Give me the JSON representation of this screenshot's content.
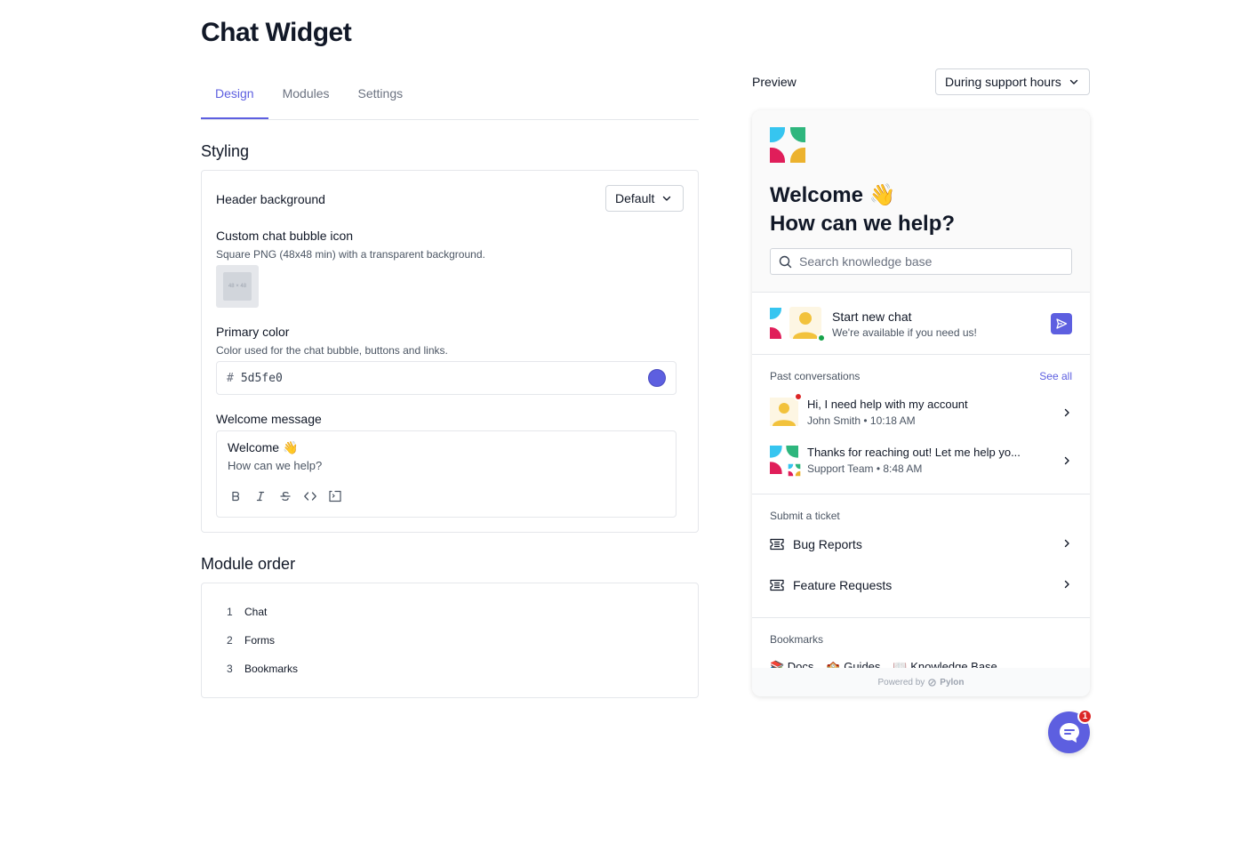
{
  "page": {
    "title": "Chat Widget"
  },
  "tabs": [
    {
      "label": "Design",
      "active": true
    },
    {
      "label": "Modules",
      "active": false
    },
    {
      "label": "Settings",
      "active": false
    }
  ],
  "styling": {
    "section_title": "Styling",
    "header_background": {
      "label": "Header background",
      "value": "Default"
    },
    "custom_icon": {
      "label": "Custom chat bubble icon",
      "help": "Square PNG (48x48 min) with a transparent background.",
      "placeholder_text": "48 × 48"
    },
    "primary_color": {
      "label": "Primary color",
      "help": "Color used for the chat bubble, buttons and links.",
      "hash": "#",
      "value": "5d5fe0",
      "swatch": "#5d5fe0"
    },
    "welcome_message": {
      "label": "Welcome message",
      "line1": "Welcome 👋",
      "line2": "How can we help?",
      "toolbar": [
        "bold-icon",
        "italic-icon",
        "strikethrough-icon",
        "code-icon",
        "code-block-icon"
      ]
    }
  },
  "module_order": {
    "section_title": "Module order",
    "items": [
      {
        "num": "1",
        "label": "Chat"
      },
      {
        "num": "2",
        "label": "Forms"
      },
      {
        "num": "3",
        "label": "Bookmarks"
      }
    ]
  },
  "preview": {
    "label": "Preview",
    "mode": "During support hours",
    "widget": {
      "welcome": "Welcome 👋",
      "help": "How can we help?",
      "search_placeholder": "Search knowledge base",
      "start_chat": {
        "title": "Start new chat",
        "subtitle": "We're available if you need us!"
      },
      "past": {
        "title": "Past conversations",
        "see_all": "See all",
        "items": [
          {
            "title": "Hi, I need help with my account",
            "sub": "John Smith • 10:18 AM"
          },
          {
            "title": "Thanks for reaching out! Let me help yo...",
            "sub": "Support Team • 8:48 AM"
          }
        ]
      },
      "tickets": {
        "title": "Submit a ticket",
        "items": [
          {
            "label": "Bug Reports"
          },
          {
            "label": "Feature Requests"
          }
        ]
      },
      "bookmarks": {
        "title": "Bookmarks",
        "items": [
          "📚 Docs",
          "🏫 Guides",
          "📖 Knowledge Base"
        ]
      },
      "powered_by": "Powered by",
      "brand": "Pylon"
    },
    "bubble_badge": "1"
  },
  "colors": {
    "primary": "#5d5fe0",
    "logo": [
      "#36c5f0",
      "#2eb67d",
      "#e01e5a",
      "#ecb22e"
    ]
  }
}
